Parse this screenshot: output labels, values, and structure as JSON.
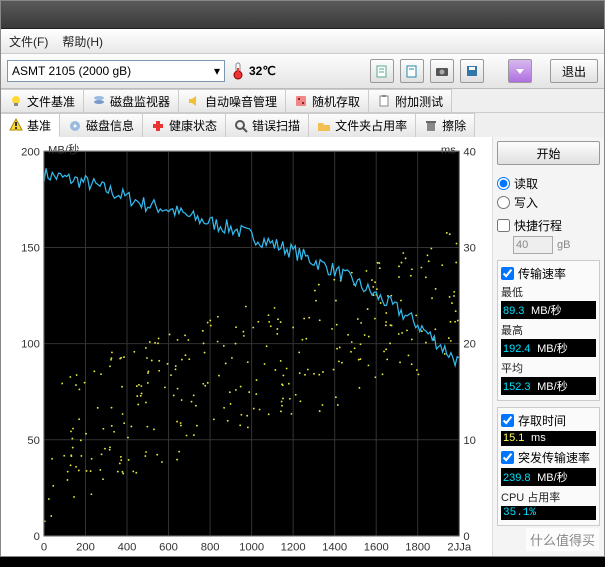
{
  "menu": {
    "file": "文件(F)",
    "help": "帮助(H)"
  },
  "toolbar": {
    "device": "ASMT  2105 (2000 gB)",
    "temp": "32℃",
    "exit": "退出"
  },
  "tabs1": [
    {
      "label": "文件基准"
    },
    {
      "label": "磁盘监视器"
    },
    {
      "label": "自动噪音管理"
    },
    {
      "label": "随机存取"
    },
    {
      "label": "附加测试"
    }
  ],
  "tabs2": [
    {
      "label": "基准",
      "active": true
    },
    {
      "label": "磁盘信息"
    },
    {
      "label": "健康状态"
    },
    {
      "label": "错误扫描"
    },
    {
      "label": "文件夹占用率"
    },
    {
      "label": "擦除"
    }
  ],
  "right": {
    "start": "开始",
    "read": "读取",
    "write": "写入",
    "short_stroke": "快捷行程",
    "short_val": "40",
    "short_unit": "gB",
    "transfer_rate": "传输速率",
    "min_label": "最低",
    "min_val": "89.3",
    "max_label": "最高",
    "max_val": "192.4",
    "avg_label": "平均",
    "avg_val": "152.3",
    "mbps": "MB/秒",
    "access_time": "存取时间",
    "access_val": "15.1",
    "ms": "ms",
    "burst": "突发传输速率",
    "burst_val": "239.8",
    "cpu": "CPU 占用率",
    "cpu_val": "35.1%"
  },
  "chart_data": {
    "type": "line",
    "xlabel_left": "MB/秒",
    "xlabel_right": "ms",
    "y_left_ticks": [
      0,
      50,
      100,
      150,
      200
    ],
    "y_right_ticks": [
      0,
      10,
      20,
      30,
      40
    ],
    "x_ticks": [
      0,
      200,
      400,
      600,
      800,
      1000,
      1200,
      1400,
      1600,
      1800
    ],
    "x_end_label": "2JJa",
    "x_max": 2000,
    "series": [
      {
        "name": "transfer_rate_MBps",
        "axis": "left",
        "color": "#33bbee",
        "x": [
          0,
          100,
          200,
          300,
          400,
          500,
          600,
          700,
          800,
          900,
          1000,
          1100,
          1200,
          1300,
          1400,
          1500,
          1600,
          1700,
          1800,
          1900,
          2000
        ],
        "y": [
          188,
          186,
          184,
          180,
          176,
          172,
          170,
          166,
          163,
          160,
          156,
          152,
          148,
          143,
          138,
          132,
          125,
          118,
          110,
          100,
          90
        ]
      }
    ],
    "scatter": {
      "name": "access_time_ms",
      "axis": "right",
      "color": "#e6e640",
      "count": 300,
      "x_range": [
        0,
        2000
      ],
      "y_center_line": [
        [
          0,
          8
        ],
        [
          200,
          11
        ],
        [
          400,
          13
        ],
        [
          800,
          16
        ],
        [
          1200,
          19
        ],
        [
          1600,
          22
        ],
        [
          2000,
          25
        ]
      ],
      "y_spread": 7
    }
  },
  "watermark": "什么值得买"
}
